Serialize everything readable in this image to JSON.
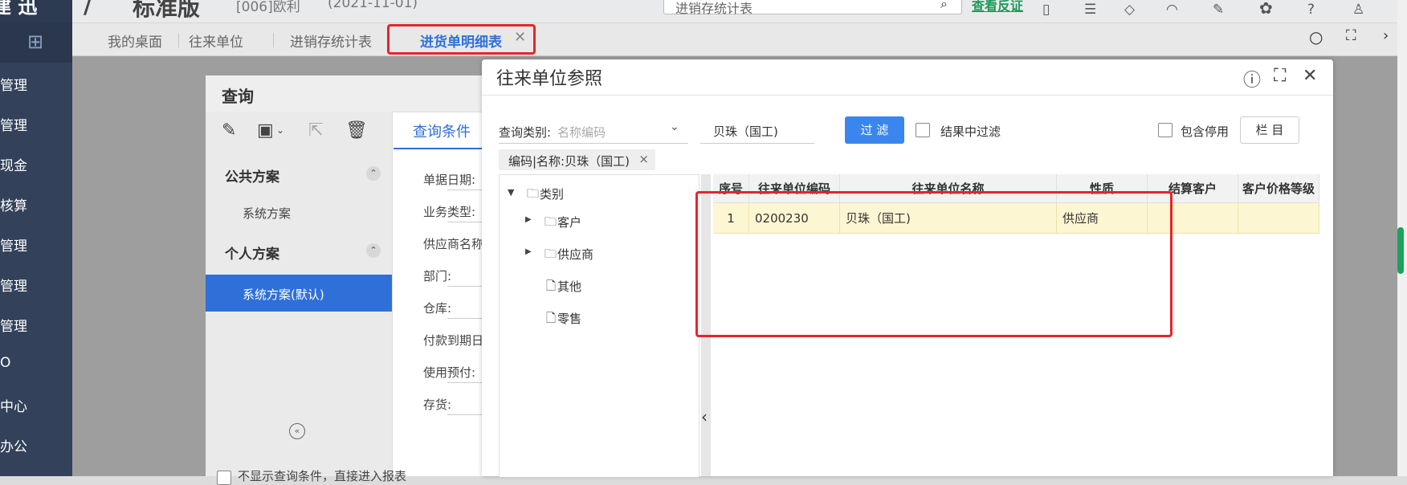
{
  "header": {
    "logo_text": "建 迅",
    "edition": "标准版",
    "account": "[006]欧利",
    "date": "(2021-11-01)",
    "search_text": "进销存统计表",
    "link_text": "查看反证"
  },
  "sidebar": {
    "items": [
      "管理",
      "管理",
      "现金",
      "核算",
      "管理",
      "管理",
      "管理",
      "O",
      "中心",
      "办公"
    ]
  },
  "tabs": [
    {
      "label": "我的桌面"
    },
    {
      "label": "往来单位"
    },
    {
      "label": "进销存统计表"
    },
    {
      "label": "进货单明细表",
      "active": true
    }
  ],
  "query_dialog": {
    "title": "查询",
    "public_scheme": "公共方案",
    "public_items": [
      "系统方案"
    ],
    "personal_scheme": "个人方案",
    "personal_items": [
      "系统方案(默认)"
    ],
    "tab_label": "查询条件",
    "fields": [
      "单据日期:",
      "业务类型:",
      "供应商名称",
      "部门:",
      "仓库:",
      "付款到期日",
      "使用预付:",
      "存货:"
    ],
    "bottom_text": "不显示查询条件，直接进入报表"
  },
  "partner_dialog": {
    "title": "往来单位参照",
    "query_type_label": "查询类别:",
    "query_type_placeholder": "名称编码",
    "search_value": "贝珠（国工)",
    "filter_button": "过 滤",
    "filter_in_results": "结果中过滤",
    "include_disabled": "包含停用",
    "columns_button": "栏 目",
    "chip": "编码|名称:贝珠（国工)",
    "tree": {
      "root": "类别",
      "nodes": [
        "客户",
        "供应商",
        "其他",
        "零售"
      ]
    },
    "grid": {
      "headers": [
        "序号",
        "往来单位编码",
        "往来单位名称",
        "性质",
        "结算客户",
        "客户价格等级"
      ],
      "rows": [
        [
          "1",
          "0200230",
          "贝珠（国工)",
          "供应商",
          "",
          ""
        ]
      ]
    }
  }
}
